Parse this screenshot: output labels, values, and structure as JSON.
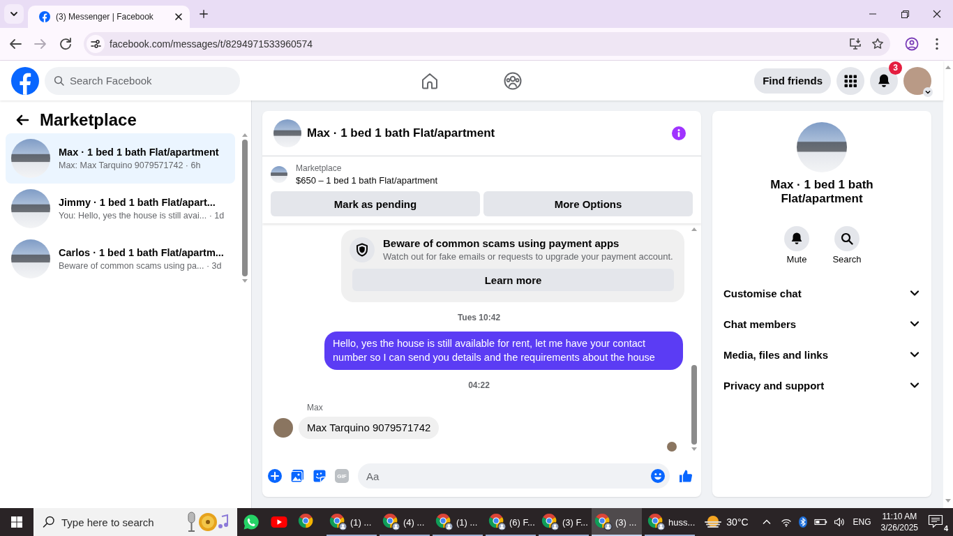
{
  "browser": {
    "tab_title": "(3) Messenger | Facebook",
    "url": "facebook.com/messages/t/8294971533960574"
  },
  "header": {
    "search_placeholder": "Search Facebook",
    "find_friends": "Find friends",
    "notification_count": "3"
  },
  "sidebar": {
    "title": "Marketplace",
    "conversations": [
      {
        "title": "Max · 1 bed 1 bath Flat/apartment",
        "snippet": "Max: Max Tarquino 9079571742 · 6h",
        "selected": true
      },
      {
        "title": "Jimmy · 1 bed 1 bath Flat/apart...",
        "snippet": "You: Hello, yes the house is still avai... · 1d",
        "selected": false
      },
      {
        "title": "Carlos · 1 bed 1 bath Flat/apartm...",
        "snippet": "Beware of common scams using pa... · 3d",
        "selected": false
      }
    ]
  },
  "chat": {
    "title": "Max · 1 bed 1 bath Flat/apartment",
    "listing": {
      "source": "Marketplace",
      "summary": "$650 – 1 bed 1 bath Flat/apartment"
    },
    "actions": [
      "Mark as pending",
      "More Options"
    ],
    "messages": [
      {
        "kind": "notice",
        "title": "Beware of common scams using payment apps",
        "text": "Watch out for fake emails or requests to upgrade your payment account.",
        "button": "Learn more"
      },
      {
        "kind": "timestamp",
        "text": "Tues 10:42"
      },
      {
        "kind": "outgoing",
        "text": "Hello, yes the house is still available for rent, let me have your contact number so I can send you details and the requirements about the house"
      },
      {
        "kind": "timestamp",
        "text": "04:22"
      },
      {
        "kind": "incoming",
        "sender": "Max",
        "text": "Max Tarquino 9079571742"
      }
    ],
    "composer": {
      "gif_label": "GIF",
      "placeholder": "Aa"
    }
  },
  "details": {
    "title": "Max · 1 bed 1 bath Flat/apartment",
    "actions": [
      {
        "kind": "mute",
        "label": "Mute"
      },
      {
        "kind": "search",
        "label": "Search"
      }
    ],
    "sections": [
      {
        "label": "Customise chat",
        "expanded": false
      },
      {
        "label": "Chat members",
        "expanded": false
      },
      {
        "label": "Media, files and links",
        "expanded": false
      },
      {
        "label": "Privacy and support",
        "expanded": false
      }
    ]
  },
  "taskbar": {
    "search_placeholder": "Type here to search",
    "pinned": [
      {
        "kind": "whatsapp"
      },
      {
        "kind": "youtube"
      },
      {
        "kind": "chrome"
      }
    ],
    "windows": [
      {
        "label": "(1) ...",
        "selected": false
      },
      {
        "label": "(4) ...",
        "selected": false
      },
      {
        "label": "(1) ...",
        "selected": false
      },
      {
        "label": "(6) F...",
        "selected": false
      },
      {
        "label": "(3) F...",
        "selected": false
      },
      {
        "label": "(3) ...",
        "selected": true
      },
      {
        "label": "huss...",
        "selected": false
      }
    ],
    "weather": "30°C",
    "language": "ENG",
    "time": "11:10 AM",
    "date": "3/26/2025",
    "notification_count": "4"
  }
}
